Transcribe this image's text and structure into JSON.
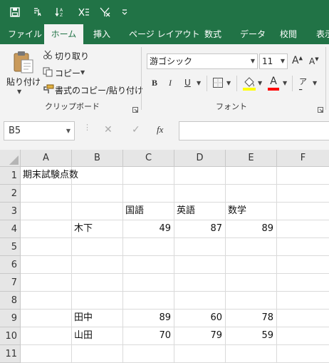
{
  "title_bar": {
    "quick_access": [
      "save-icon",
      "touch-mode-icon",
      "sort-ascending-icon",
      "clear-icon",
      "filter-clear-icon",
      "customize-qat-icon"
    ],
    "background": "#217346"
  },
  "ribbon_tabs": [
    "ファイル",
    "ホーム",
    "挿入",
    "ページ レイアウト",
    "数式",
    "データ",
    "校閲",
    "表示"
  ],
  "active_tab": "ホーム",
  "clipboard": {
    "paste_label": "貼り付け",
    "cut_label": "切り取り",
    "copy_label": "コピー",
    "format_painter_label": "書式のコピー/貼り付け",
    "group_label": "クリップボード"
  },
  "font": {
    "name": "游ゴシック",
    "size": "11",
    "grow_label": "A",
    "shrink_label": "A",
    "bold_label": "B",
    "italic_label": "I",
    "underline_label": "U",
    "font_color_label": "A",
    "phonetic_label": "ア",
    "group_label": "フォント",
    "fill_color": "#ffff00",
    "font_color": "#ff0000"
  },
  "formula_bar": {
    "name_box": "B5",
    "fx_label": "fx",
    "formula": ""
  },
  "columns": [
    "A",
    "B",
    "C",
    "D",
    "E",
    "F"
  ],
  "rows": [
    {
      "num": "1",
      "A": "期末試験点数",
      "B": "",
      "C": "",
      "D": "",
      "E": ""
    },
    {
      "num": "2",
      "A": "",
      "B": "",
      "C": "",
      "D": "",
      "E": ""
    },
    {
      "num": "3",
      "A": "",
      "B": "",
      "C": "国語",
      "D": "英語",
      "E": "数学"
    },
    {
      "num": "4",
      "A": "",
      "B": "木下",
      "C": "49",
      "D": "87",
      "E": "89"
    },
    {
      "num": "5",
      "A": "",
      "B": "",
      "C": "",
      "D": "",
      "E": ""
    },
    {
      "num": "6",
      "A": "",
      "B": "",
      "C": "",
      "D": "",
      "E": ""
    },
    {
      "num": "7",
      "A": "",
      "B": "",
      "C": "",
      "D": "",
      "E": ""
    },
    {
      "num": "8",
      "A": "",
      "B": "",
      "C": "",
      "D": "",
      "E": ""
    },
    {
      "num": "9",
      "A": "",
      "B": "田中",
      "C": "89",
      "D": "60",
      "E": "78"
    },
    {
      "num": "10",
      "A": "",
      "B": "山田",
      "C": "70",
      "D": "79",
      "E": "59"
    },
    {
      "num": "11",
      "A": "",
      "B": "",
      "C": "",
      "D": "",
      "E": ""
    }
  ]
}
